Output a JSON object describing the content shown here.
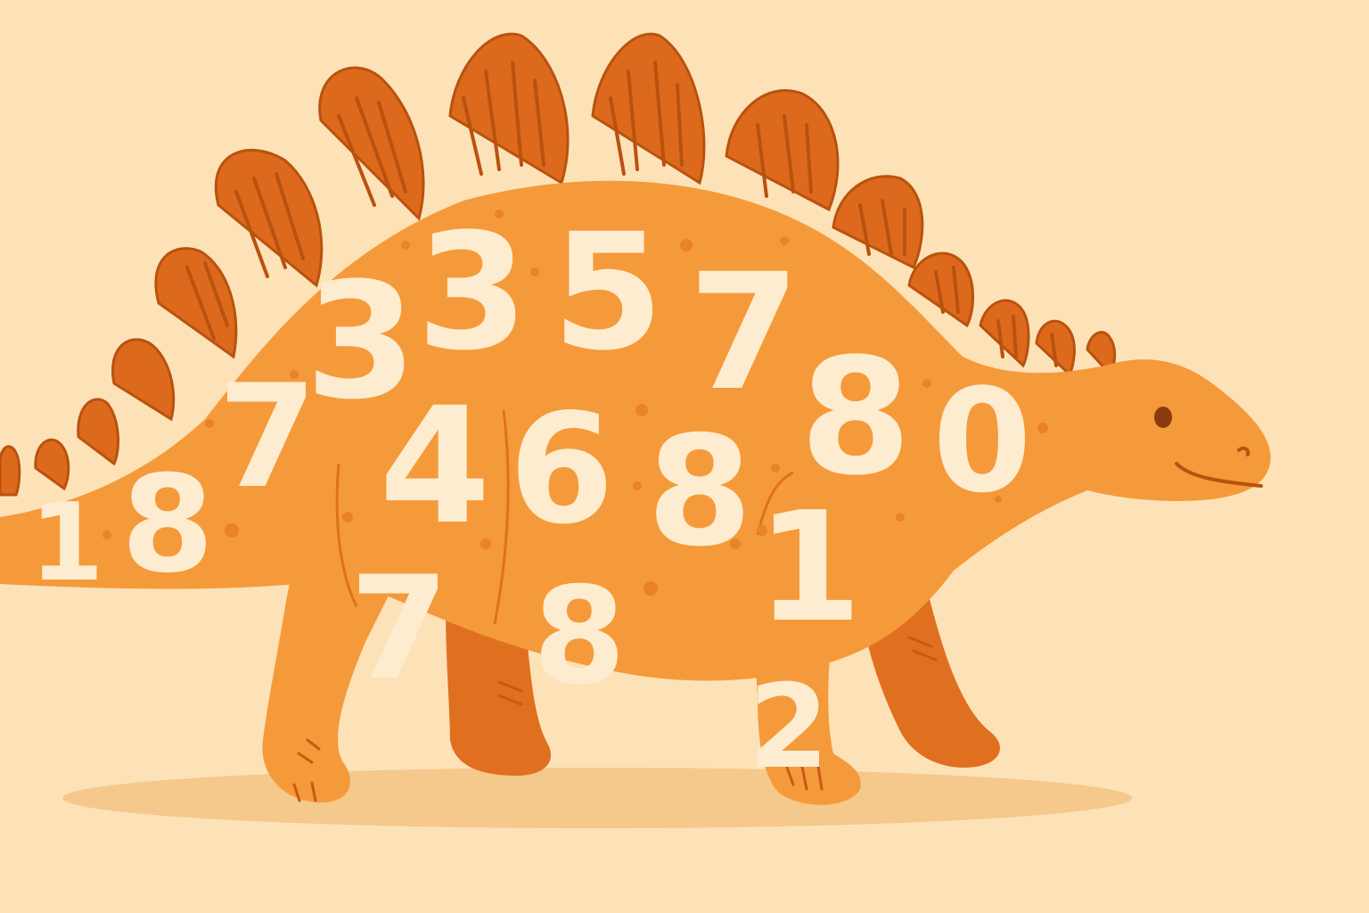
{
  "scene": {
    "subject": "stegosaurus-illustration",
    "colors": {
      "background": "#fde2b8",
      "body": "#f59a3a",
      "body_dark": "#e0701f",
      "plate": "#dd6a1c",
      "plate_line": "#b9520f",
      "spot": "#ea8228",
      "shadow": "#f5c88c",
      "numeral": "#fdecd0",
      "eye": "#8a3a10"
    }
  },
  "numbers": [
    {
      "id": "n1",
      "value": "1"
    },
    {
      "id": "n2",
      "value": "8"
    },
    {
      "id": "n3",
      "value": "7"
    },
    {
      "id": "n4",
      "value": "3"
    },
    {
      "id": "n5",
      "value": "3"
    },
    {
      "id": "n6",
      "value": "5"
    },
    {
      "id": "n7",
      "value": "7"
    },
    {
      "id": "n8",
      "value": "8"
    },
    {
      "id": "n9",
      "value": "0"
    },
    {
      "id": "n10",
      "value": "4"
    },
    {
      "id": "n11",
      "value": "6"
    },
    {
      "id": "n12",
      "value": "8"
    },
    {
      "id": "n13",
      "value": "7"
    },
    {
      "id": "n14",
      "value": "8"
    },
    {
      "id": "n15",
      "value": "1"
    },
    {
      "id": "n16",
      "value": "2"
    }
  ]
}
